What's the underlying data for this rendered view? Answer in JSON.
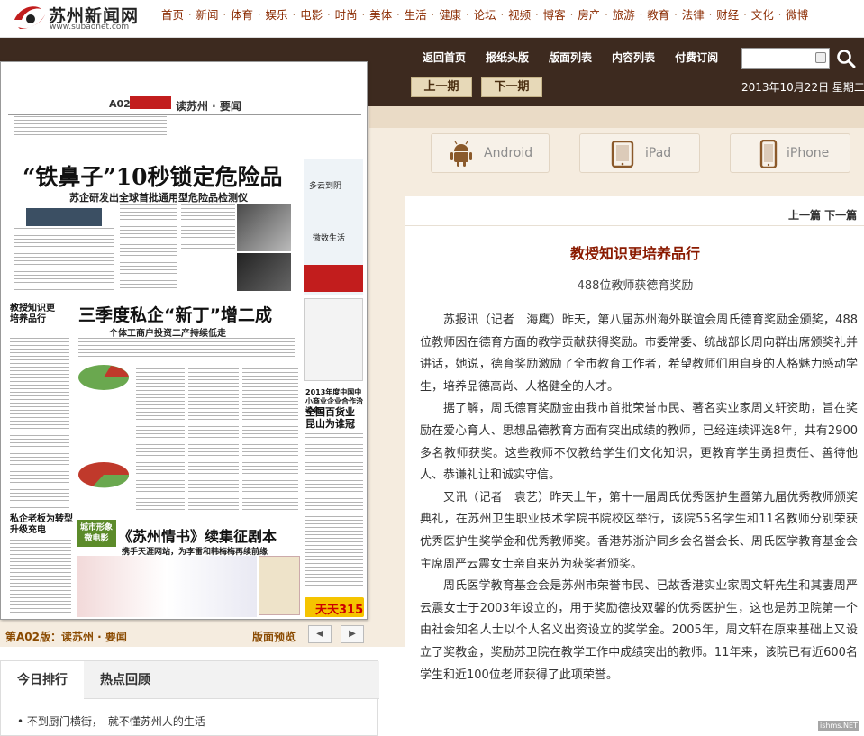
{
  "site": {
    "name": "苏州新闻网",
    "url": "www.subaonet.com",
    "brand_color": "#c21d1d",
    "band_color": "#3d2a1f"
  },
  "nav": [
    "首页",
    "新闻",
    "体育",
    "娱乐",
    "电影",
    "时尚",
    "美体",
    "生活",
    "健康",
    "论坛",
    "视频",
    "博客",
    "房产",
    "旅游",
    "教育",
    "法律",
    "财经",
    "文化",
    "微博"
  ],
  "band": {
    "links": [
      "返回首页",
      "报纸头版",
      "版面列表",
      "内容列表",
      "付费订阅"
    ],
    "search": {
      "value": "",
      "placeholder": ""
    },
    "prev_issue": "上一期",
    "next_issue": "下一期",
    "date": "2013年10月22日 星期二"
  },
  "paper": {
    "page_code": "A02",
    "header": "读苏州 · 要闻",
    "headline1": "“铁鼻子”10秒锁定危险品",
    "sub1": "苏企研发出全球首批通用型危险品检测仪",
    "headline2": "三季度私企“新丁”增二成",
    "sub2": "个体工商户投资二产持续低走",
    "side1": "教授知识更培养品行",
    "side2": "私企老板为转型升级充电",
    "headline3": "《苏州情书》续集征剧本",
    "sub3": "携手天涯网站，为李雷和韩梅梅再续前缘",
    "promo": "城市形象微电影",
    "weather": "多云到阴",
    "market": "微数生活",
    "expo_title": "2013年度中国中小商业企业合作洽谈会",
    "expo_head": "全国百货业昆山为谁冠",
    "ad_text": "天天315",
    "phone": "400-8615-688",
    "caption": "第A02版：读苏州 · 要闻",
    "preview": "版面预览",
    "prev_page": "◀",
    "next_page": "▶"
  },
  "apps": [
    {
      "name": "Android",
      "icon": "android-icon"
    },
    {
      "name": "iPad",
      "icon": "ipad-icon"
    },
    {
      "name": "iPhone",
      "icon": "iphone-icon"
    }
  ],
  "article": {
    "nav": "上一篇  下一篇",
    "title": "教授知识更培养品行",
    "subtitle": "488位教师获德育奖励",
    "paragraphs": [
      "苏报讯（记者　海鹰）昨天，第八届苏州海外联谊会周氏德育奖励金颁奖，488位教师因在德育方面的教学贡献获得奖励。市委常委、统战部长周向群出席颁奖礼并讲话，她说，德育奖励激励了全市教育工作者，希望教师们用自身的人格魅力感动学生，培养品德高尚、人格健全的人才。",
      "据了解，周氏德育奖励金由我市首批荣誉市民、著名实业家周文轩资助，旨在奖励在爱心育人、思想品德教育方面有突出成绩的教师，已经连续评选8年，共有2900多名教师获奖。这些教师不仅教给学生们文化知识，更教育学生勇担责任、善待他人、恭谦礼让和诚实守信。",
      "又讯（记者　袁艺）昨天上午，第十一届周氏优秀医护生暨第九届优秀教师颁奖典礼，在苏州卫生职业技术学院书院校区举行，该院55名学生和11名教师分别荣获优秀医护生奖学金和优秀教师奖。香港苏浙沪同乡会名誉会长、周氏医学教育基金会主席周严云震女士亲自来苏为获奖者颁奖。",
      "周氏医学教育基金会是苏州市荣誉市民、已故香港实业家周文轩先生和其妻周严云震女士于2003年设立的，用于奖励德技双馨的优秀医护生，这也是苏卫院第一个由社会知名人士以个人名义出资设立的奖学金。2005年，周文轩在原来基础上又设立了奖教金，奖励苏卫院在教学工作中成绩突出的教师。11年来，该院已有近600名学生和近100位老师获得了此项荣誉。"
    ]
  },
  "ranking": {
    "tabs": [
      "今日排行",
      "热点回顾"
    ],
    "items": [
      "不到厨门横街，　就不懂苏州人的生活"
    ]
  },
  "watermark": "ishms.NET"
}
